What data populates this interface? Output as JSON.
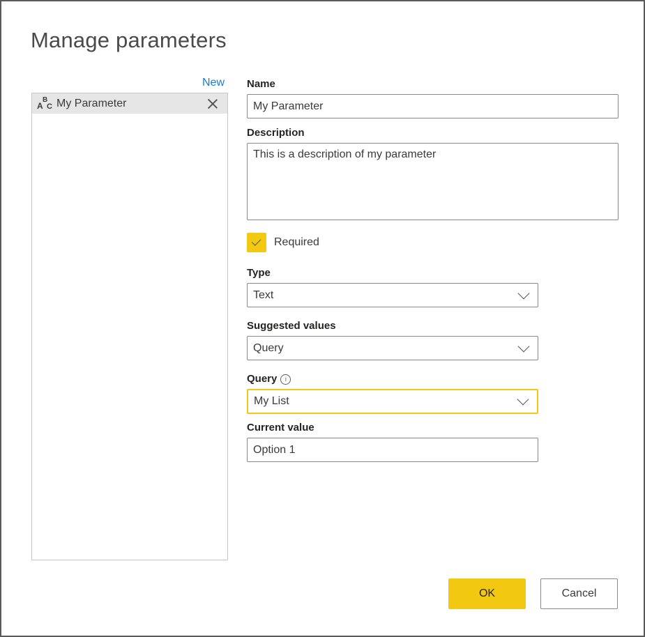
{
  "dialog": {
    "title": "Manage parameters",
    "new_link": "New",
    "parameters": [
      {
        "label": "My Parameter",
        "type_icon": "abc-text-icon",
        "selected": true
      }
    ]
  },
  "form": {
    "name": {
      "label": "Name",
      "value": "My Parameter"
    },
    "description": {
      "label": "Description",
      "value": "This is a description of my parameter"
    },
    "required": {
      "label": "Required",
      "checked": true
    },
    "type": {
      "label": "Type",
      "value": "Text"
    },
    "suggested_values": {
      "label": "Suggested values",
      "value": "Query"
    },
    "query": {
      "label": "Query",
      "value": "My List",
      "info_icon": "info-icon"
    },
    "current_value": {
      "label": "Current value",
      "value": "Option 1"
    }
  },
  "buttons": {
    "ok": "OK",
    "cancel": "Cancel"
  },
  "colors": {
    "accent": "#f2c811",
    "link": "#1a7ad4",
    "border": "#8a8886"
  }
}
